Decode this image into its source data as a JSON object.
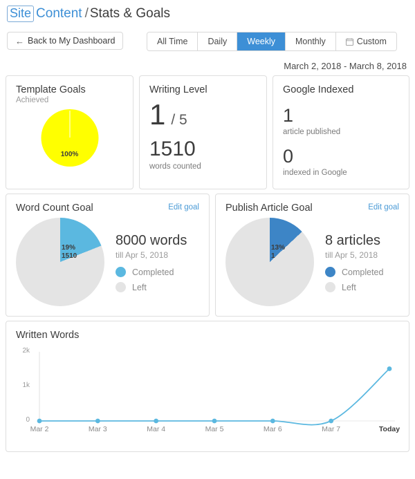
{
  "header": {
    "logo_site": "Site",
    "logo_content": "Content",
    "separator": "/",
    "page_title": "Stats & Goals"
  },
  "toolbar": {
    "back_label": "Back to My Dashboard",
    "back_icon": "arrow-left-icon",
    "tabs": [
      {
        "label": "All Time",
        "active": false
      },
      {
        "label": "Daily",
        "active": false
      },
      {
        "label": "Weekly",
        "active": true
      },
      {
        "label": "Monthly",
        "active": false
      },
      {
        "label": "Custom",
        "active": false,
        "icon": "calendar-icon"
      }
    ],
    "date_range": "March 2, 2018 - March 8, 2018"
  },
  "cards": {
    "template_goals": {
      "title": "Template Goals",
      "subtitle": "Achieved",
      "percent_label": "100%",
      "percent": 100,
      "color": "#ffff00"
    },
    "writing_level": {
      "title": "Writing Level",
      "level": "1",
      "level_of": "/ 5",
      "words": "1510",
      "words_caption": "words counted"
    },
    "google_indexed": {
      "title": "Google Indexed",
      "published": "1",
      "published_caption": "article published",
      "indexed": "0",
      "indexed_caption": "indexed in Google"
    },
    "word_count_goal": {
      "title": "Word Count Goal",
      "edit_label": "Edit goal",
      "percent_label": "19%",
      "value_label": "1510",
      "percent": 19,
      "amount": "8000 words",
      "till": "till Apr 5, 2018",
      "legend_completed": "Completed",
      "legend_left": "Left",
      "color_completed": "#5bb8e0",
      "color_left": "#e4e4e4"
    },
    "publish_article_goal": {
      "title": "Publish Article Goal",
      "edit_label": "Edit goal",
      "percent_label": "13%",
      "value_label": "1",
      "percent": 13,
      "amount": "8 articles",
      "till": "till Apr 5, 2018",
      "legend_completed": "Completed",
      "legend_left": "Left",
      "color_completed": "#3d85c6",
      "color_left": "#e4e4e4"
    }
  },
  "chart_data": {
    "type": "line",
    "title": "Written Words",
    "x": [
      "Mar 2",
      "Mar 3",
      "Mar 4",
      "Mar 5",
      "Mar 6",
      "Mar 7",
      "Today"
    ],
    "values": [
      0,
      0,
      0,
      0,
      0,
      0,
      1510
    ],
    "ylim": [
      0,
      2000
    ],
    "yticks": [
      0,
      1000,
      2000
    ],
    "ytick_labels": [
      "0",
      "1k",
      "2k"
    ],
    "xlabel": "",
    "ylabel": "",
    "grid": false,
    "legend": "none",
    "line_color": "#5bb8e0",
    "point_color": "#5bb8e0"
  }
}
